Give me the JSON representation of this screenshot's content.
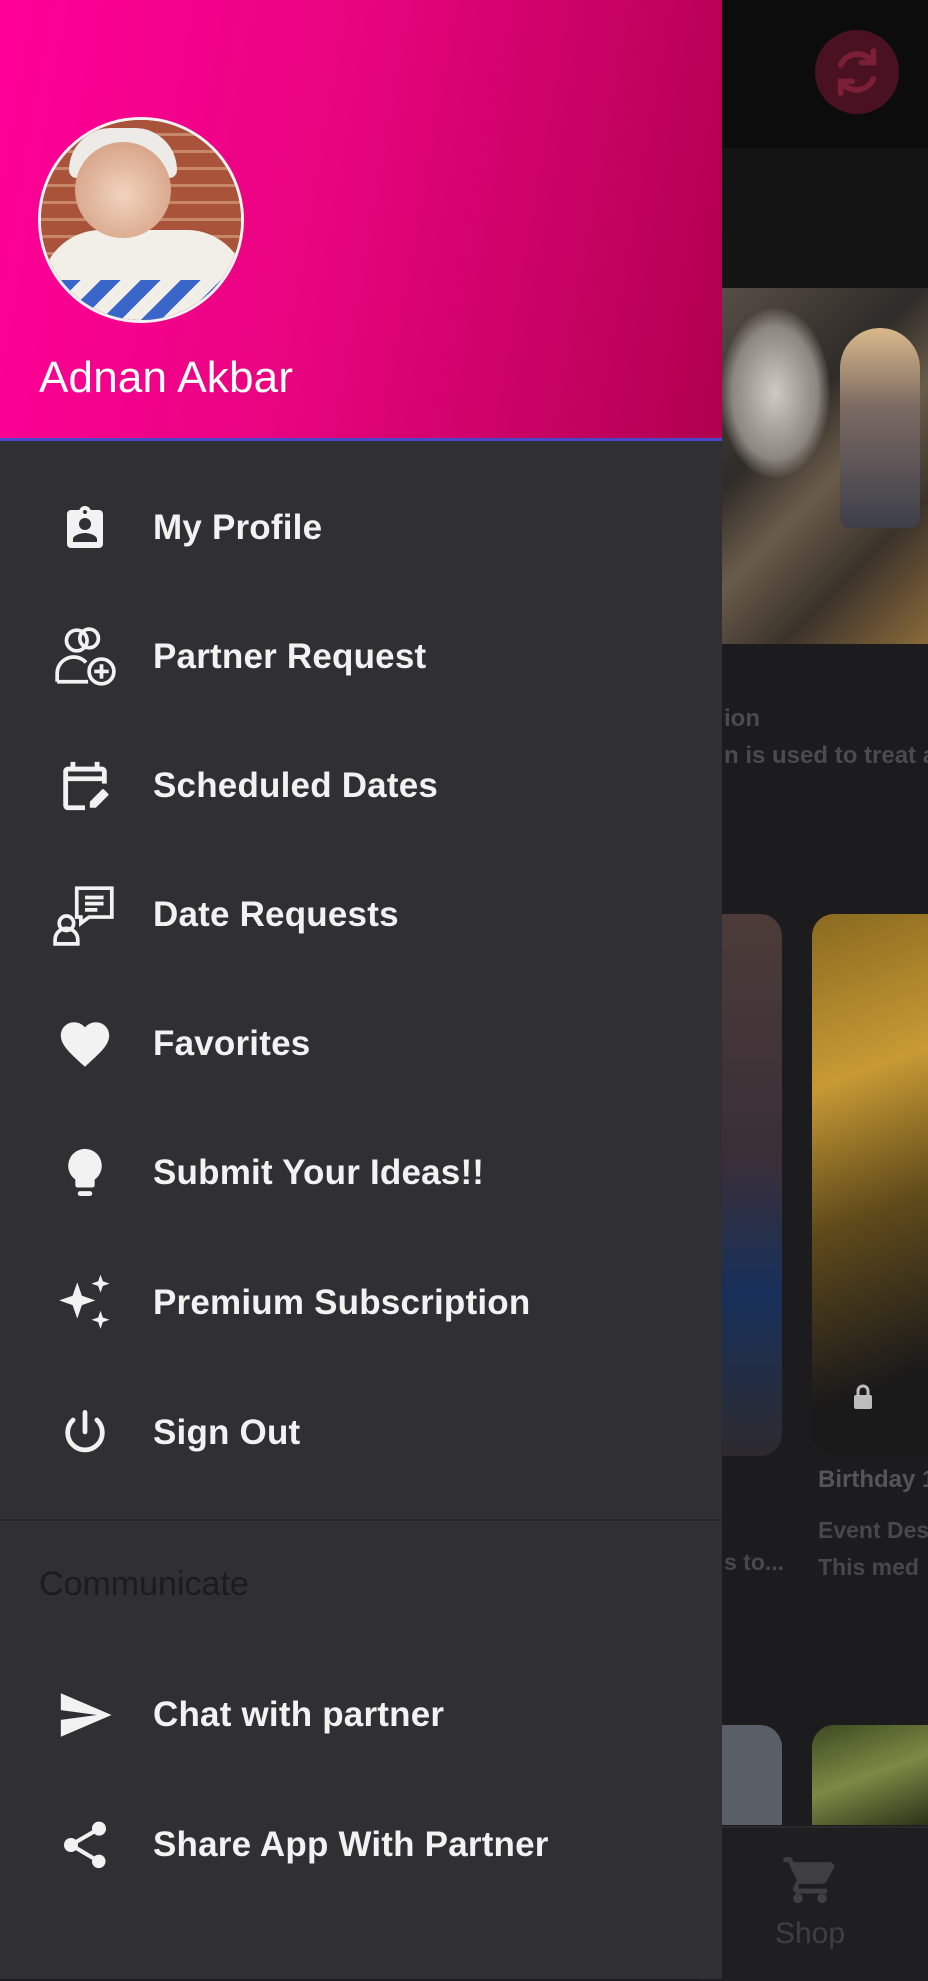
{
  "user": {
    "name": "Adnan Akbar"
  },
  "menu": {
    "items": [
      {
        "label": "My Profile",
        "icon": "badge-icon"
      },
      {
        "label": "Partner Request",
        "icon": "add-user-icon"
      },
      {
        "label": "Scheduled Dates",
        "icon": "calendar-edit-icon"
      },
      {
        "label": "Date Requests",
        "icon": "person-chat-icon"
      },
      {
        "label": "Favorites",
        "icon": "heart-icon"
      },
      {
        "label": "Submit Your Ideas!!",
        "icon": "lightbulb-icon"
      },
      {
        "label": "Premium Subscription",
        "icon": "sparkles-icon"
      },
      {
        "label": "Sign Out",
        "icon": "power-icon"
      }
    ],
    "section_title": "Communicate",
    "communicate_items": [
      {
        "label": "Chat with partner",
        "icon": "send-icon"
      },
      {
        "label": "Share App With Partner",
        "icon": "share-icon"
      }
    ]
  },
  "background": {
    "desc_line1": "ion",
    "desc_line2": "n is used to treat a",
    "card_title": "Birthday 1",
    "card_desc_line1": "Event Des",
    "card_desc_line2": "This med",
    "card_desc_left": "s to...",
    "bottom_nav_label": "Shop"
  },
  "colors": {
    "header_start": "#ff0099",
    "header_end": "#b0004f",
    "drawer_bg": "#303034",
    "text": "#f2f2f2"
  }
}
